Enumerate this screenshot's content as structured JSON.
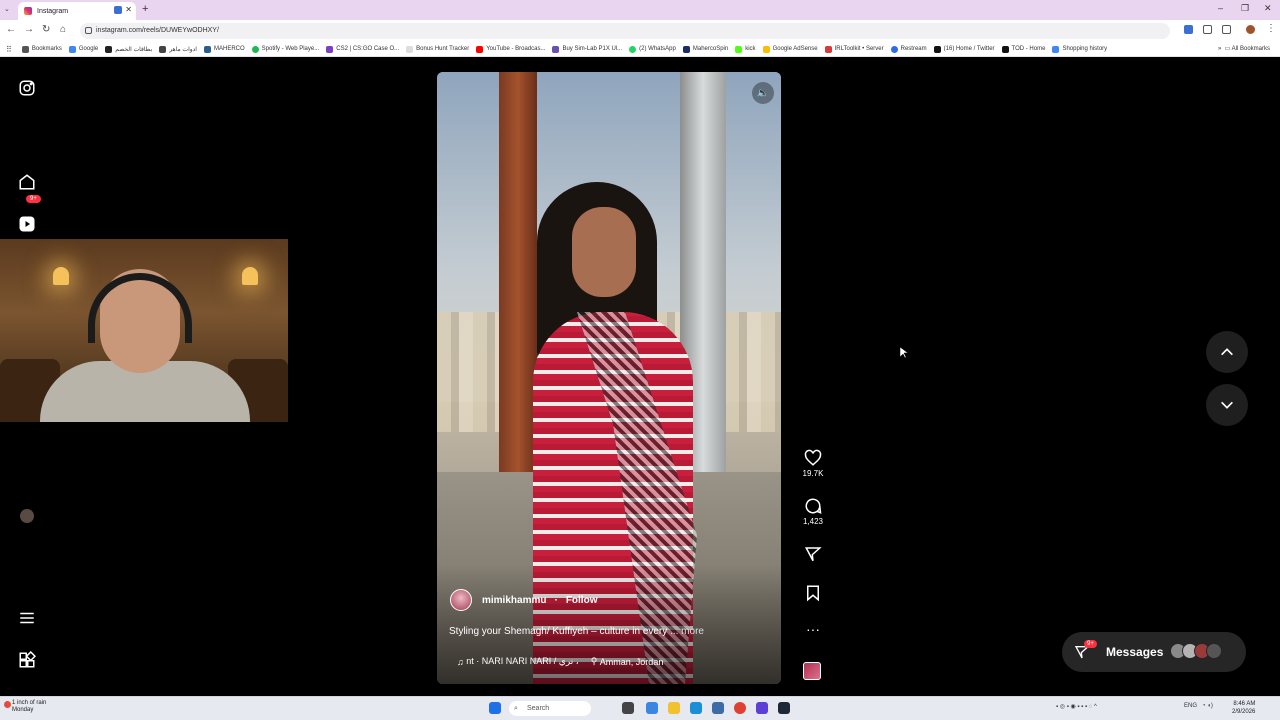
{
  "browser": {
    "tab_title": "Instagram",
    "url": "instagram.com/reels/DUWEYwODHXY/",
    "new_tab": "+",
    "window_controls": [
      "–",
      "❐",
      "✕"
    ],
    "bookmarks": [
      {
        "label": "Bookmarks",
        "color": "#555555"
      },
      {
        "label": "Google",
        "color": "#4285f4"
      },
      {
        "label": "بطاقات الخصم",
        "color": "#222222"
      },
      {
        "label": "ادوات ماهر",
        "color": "#444444"
      },
      {
        "label": "MAHERCO",
        "color": "#2b5f8a"
      },
      {
        "label": "Spotify - Web Playe...",
        "color": "#1db954"
      },
      {
        "label": "CS2 | CS:GO Case O...",
        "color": "#7b3fc4"
      },
      {
        "label": "Bonus Hunt Tracker",
        "color": "#dddddd"
      },
      {
        "label": "YouTube - Broadcas...",
        "color": "#ff0000"
      },
      {
        "label": "Buy Sim-Lab P1X Ul...",
        "color": "#6a4fb3"
      },
      {
        "label": "(2) WhatsApp",
        "color": "#25d366"
      },
      {
        "label": "MahercoSpin",
        "color": "#1c2a66"
      },
      {
        "label": "kick",
        "color": "#53fc18"
      },
      {
        "label": "Google AdSense",
        "color": "#fbbc04"
      },
      {
        "label": "IRLToolkit • Server",
        "color": "#d63a3a"
      },
      {
        "label": "Restream",
        "color": "#2e6be6"
      },
      {
        "label": "(16) Home / Twitter",
        "color": "#111111"
      },
      {
        "label": "TOD - Home",
        "color": "#111111"
      },
      {
        "label": "Shopping history",
        "color": "#4285f4"
      }
    ],
    "all_bookmarks": "All Bookmarks"
  },
  "sidebar": {
    "notifications_badge": "9+"
  },
  "reel": {
    "author": "mimikhammu",
    "follow_label": "Follow",
    "caption": "Styling your Shemagh/ Kuffiyeh – culture in every",
    "more_label": "... more",
    "audio": "nt · NARI NARI NARI / نري ،",
    "location": "Amman, Jordan"
  },
  "actions": {
    "likes": "19.7K",
    "comments": "1,423"
  },
  "messages": {
    "label": "Messages",
    "badge": "9+"
  },
  "taskbar": {
    "weather_line1": "1 inch of rain",
    "weather_line2": "Monday",
    "search_placeholder": "Search",
    "lang": "ENG",
    "time": "8:46 AM",
    "date": "2/9/2026"
  }
}
